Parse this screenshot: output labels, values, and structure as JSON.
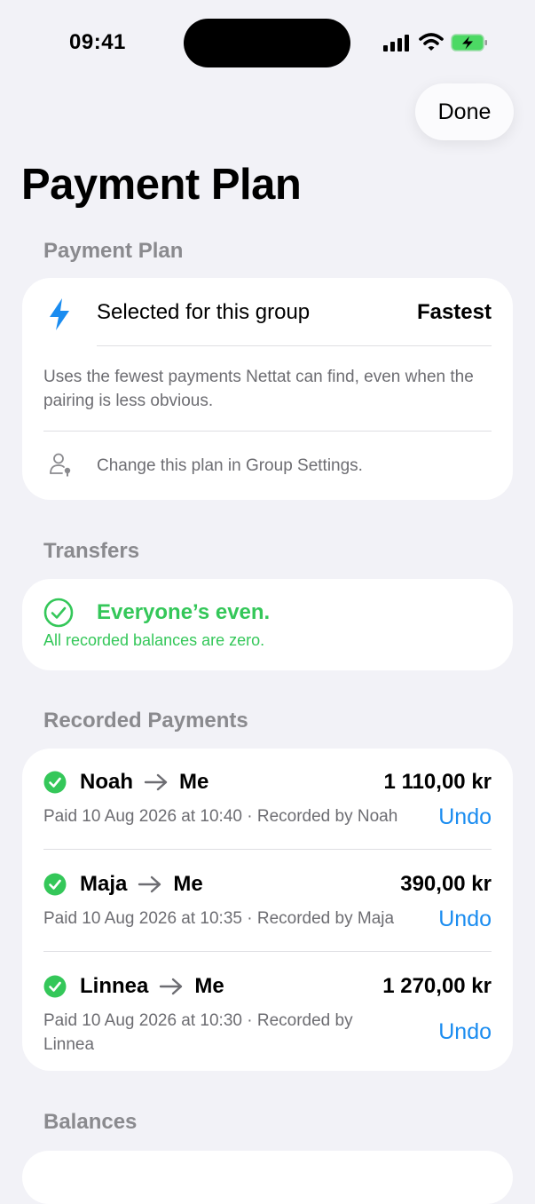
{
  "status_bar": {
    "time": "09:41"
  },
  "toolbar": {
    "done_label": "Done"
  },
  "page": {
    "title": "Payment Plan"
  },
  "payment_plan": {
    "header": "Payment Plan",
    "selected_label": "Selected for this group",
    "selected_value": "Fastest",
    "description": "Uses the fewest payments Nettat can find, even when the pairing is less obvious.",
    "settings_note": "Change this plan in Group Settings."
  },
  "transfers": {
    "header": "Transfers",
    "status_title": "Everyone’s even.",
    "status_subtitle": "All recorded balances are zero."
  },
  "recorded_payments": {
    "header": "Recorded Payments",
    "items": [
      {
        "from": "Noah",
        "to": "Me",
        "amount": "1 110,00 kr",
        "meta": "Paid 10 Aug 2026 at 10:40 · Recorded by Noah",
        "undo_label": "Undo"
      },
      {
        "from": "Maja",
        "to": "Me",
        "amount": "390,00 kr",
        "meta": "Paid 10 Aug 2026 at 10:35 · Recorded by Maja",
        "undo_label": "Undo"
      },
      {
        "from": "Linnea",
        "to": "Me",
        "amount": "1 270,00 kr",
        "meta": "Paid 10 Aug 2026 at 10:30 · Recorded by Linnea",
        "undo_label": "Undo"
      }
    ]
  },
  "balances": {
    "header": "Balances"
  },
  "colors": {
    "accent": "#1a8cf0",
    "success": "#34c759",
    "background": "#f2f2f7"
  }
}
